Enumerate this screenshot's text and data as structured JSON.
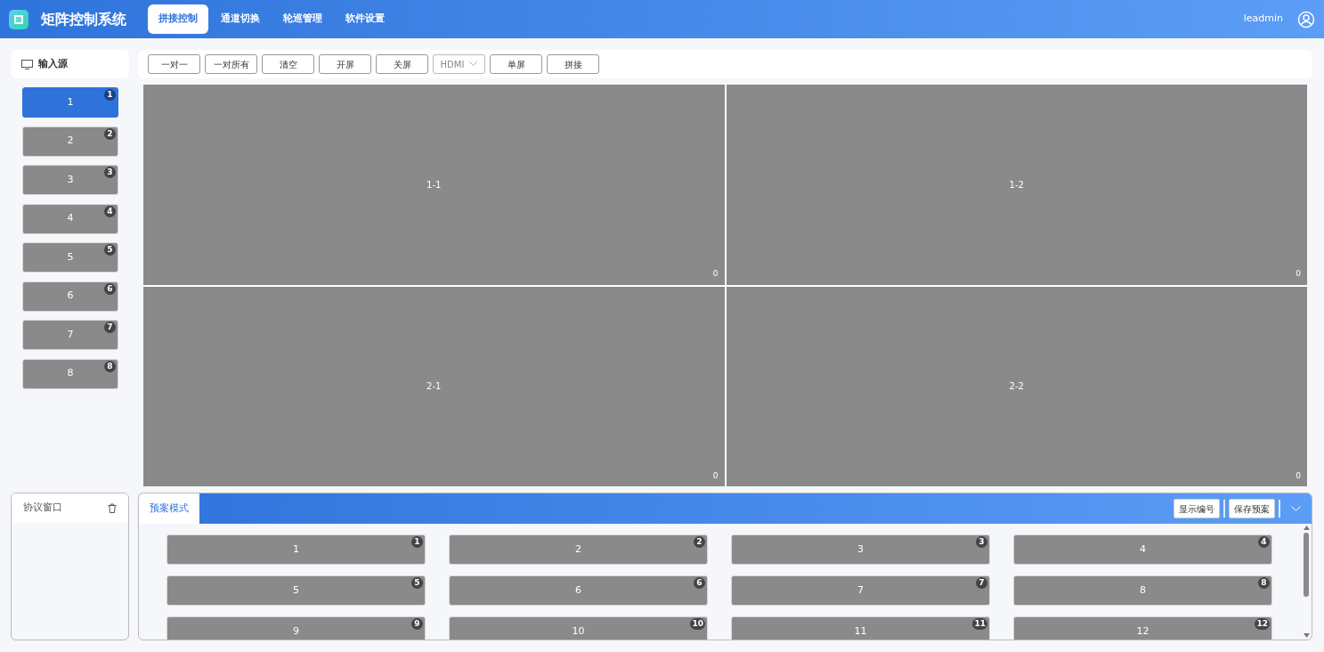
{
  "app": {
    "title": "矩阵控制系统"
  },
  "nav_tabs": [
    {
      "label": "拼接控制",
      "selected": true
    },
    {
      "label": "通道切换",
      "selected": false
    },
    {
      "label": "轮巡管理",
      "selected": false
    },
    {
      "label": "软件设置",
      "selected": false
    }
  ],
  "user": {
    "name": "leadmin"
  },
  "input_sources": {
    "title": "输入源",
    "items": [
      {
        "label": "1",
        "badge": "1",
        "selected": true
      },
      {
        "label": "2",
        "badge": "2",
        "selected": false
      },
      {
        "label": "3",
        "badge": "3",
        "selected": false
      },
      {
        "label": "4",
        "badge": "4",
        "selected": false
      },
      {
        "label": "5",
        "badge": "5",
        "selected": false
      },
      {
        "label": "6",
        "badge": "6",
        "selected": false
      },
      {
        "label": "7",
        "badge": "7",
        "selected": false
      },
      {
        "label": "8",
        "badge": "8",
        "selected": false
      }
    ]
  },
  "toolbar": [
    {
      "kind": "button",
      "label": "一对一"
    },
    {
      "kind": "button",
      "label": "一对所有"
    },
    {
      "kind": "button",
      "label": "清空"
    },
    {
      "kind": "button",
      "label": "开屏"
    },
    {
      "kind": "button",
      "label": "关屏"
    },
    {
      "kind": "select",
      "label": "HDMI"
    },
    {
      "kind": "button",
      "label": "单屏"
    },
    {
      "kind": "button",
      "label": "拼接"
    }
  ],
  "screens": [
    {
      "label": "1-1",
      "count": "0"
    },
    {
      "label": "1-2",
      "count": "0"
    },
    {
      "label": "2-1",
      "count": "0"
    },
    {
      "label": "2-2",
      "count": "0"
    }
  ],
  "protocol_window": {
    "title": "协议窗口"
  },
  "presets": {
    "tab": "预案模式",
    "buttons": [
      "显示编号",
      "保存预案"
    ],
    "items": [
      {
        "label": "1",
        "badge": "1"
      },
      {
        "label": "2",
        "badge": "2"
      },
      {
        "label": "3",
        "badge": "3"
      },
      {
        "label": "4",
        "badge": "4"
      },
      {
        "label": "5",
        "badge": "5"
      },
      {
        "label": "6",
        "badge": "6"
      },
      {
        "label": "7",
        "badge": "7"
      },
      {
        "label": "8",
        "badge": "8"
      },
      {
        "label": "9",
        "badge": "9"
      },
      {
        "label": "10",
        "badge": "10"
      },
      {
        "label": "11",
        "badge": "11"
      },
      {
        "label": "12",
        "badge": "12"
      }
    ]
  }
}
